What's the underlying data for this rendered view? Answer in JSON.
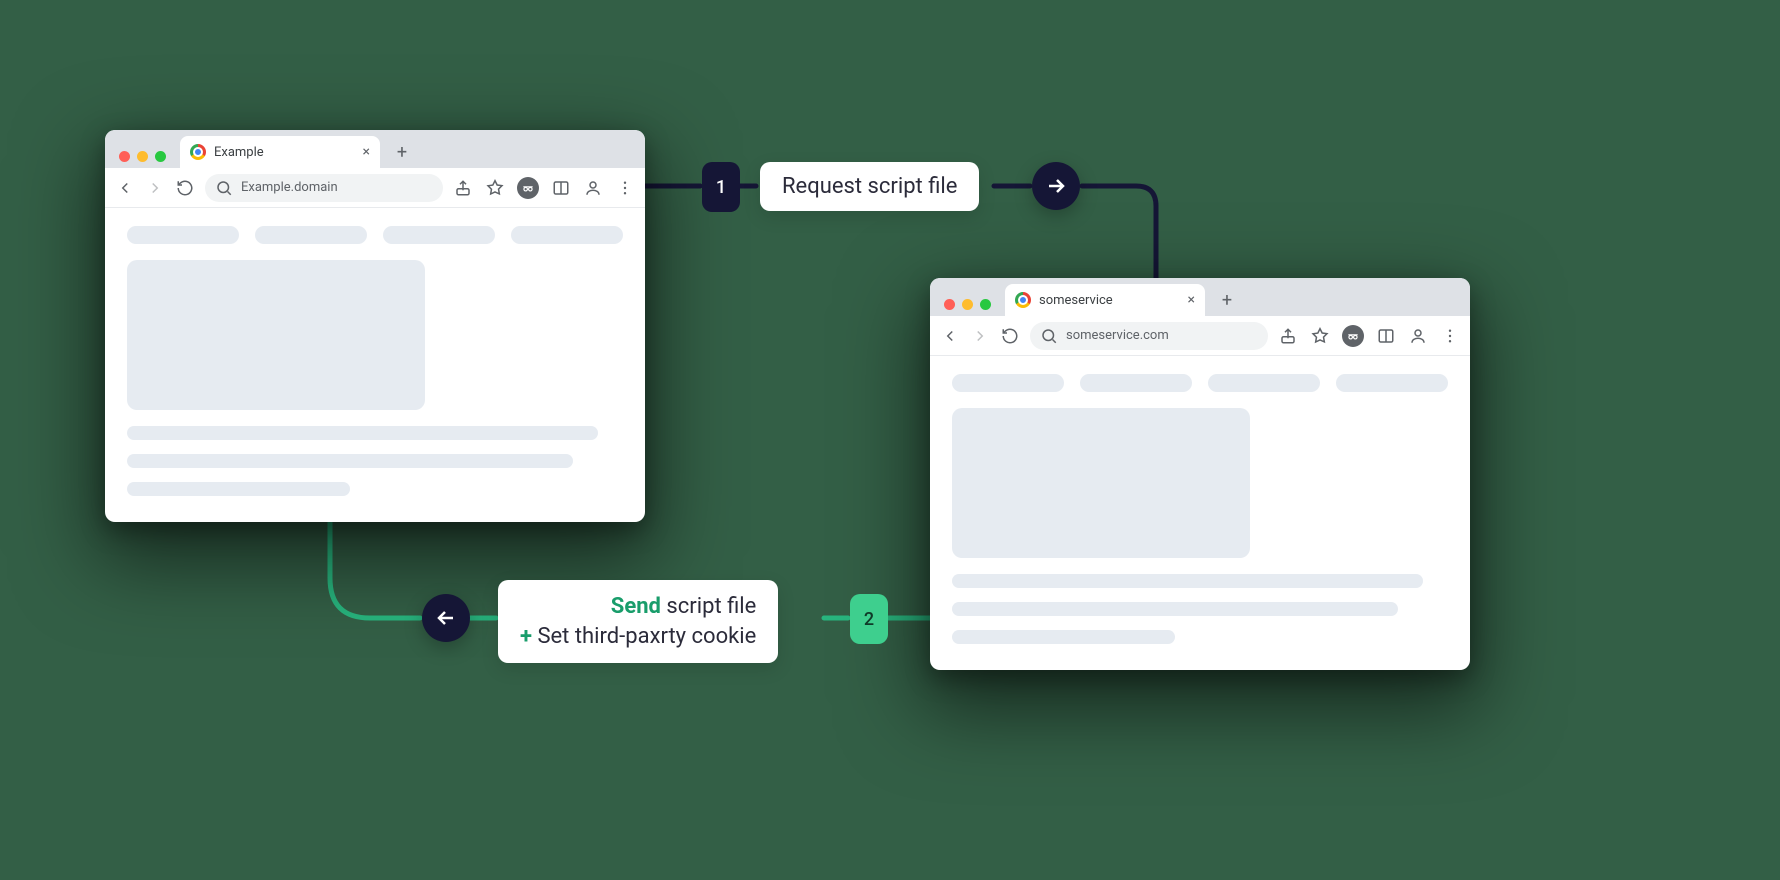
{
  "browserA": {
    "tabTitle": "Example",
    "url": "Example.domain"
  },
  "browserB": {
    "tabTitle": "someservice",
    "url": "someservice.com"
  },
  "step1": {
    "number": "1",
    "label": "Request script file"
  },
  "step2": {
    "number": "2",
    "sendWord": "Send",
    "sendRest": " script file",
    "plus": "+",
    "setCookie": " Set third-paxrty cookie"
  },
  "colors": {
    "dark": "#151636",
    "green": "#3ECF8E",
    "greenLine": "#28b57e"
  }
}
